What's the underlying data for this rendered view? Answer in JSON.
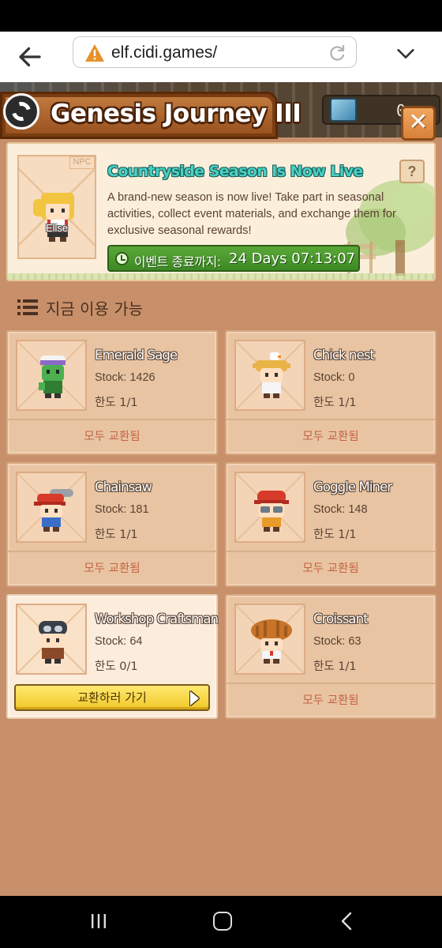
{
  "browser": {
    "url": "elf.cidi.games/"
  },
  "header": {
    "title": "Genesis Journey III",
    "currency_amount": "0",
    "close_label": "✕"
  },
  "event": {
    "npc_tag": "NPC",
    "npc_name": "Elise",
    "title": "Countryside Season Is Now Live",
    "description": "A brand-new season is now live! Take part in seasonal activities, collect event materials, and exchange them for exclusive seasonal rewards!",
    "timer_label": "이벤트 종료까지:",
    "timer_value": "24 Days  07:13:07",
    "help_label": "?"
  },
  "section": {
    "title": "지금 이용 가능"
  },
  "items": [
    {
      "name": "Emerald Sage",
      "stock": "Stock: 1426",
      "limit": "한도 1/1",
      "status": "모두 교환됨"
    },
    {
      "name": "Chick nest",
      "stock": "Stock: 0",
      "limit": "한도 1/1",
      "status": "모두 교환됨"
    },
    {
      "name": "Chainsaw",
      "stock": "Stock: 181",
      "limit": "한도 1/1",
      "status": "모두 교환됨"
    },
    {
      "name": "Goggle Miner",
      "stock": "Stock: 148",
      "limit": "한도 1/1",
      "status": "모두 교환됨"
    },
    {
      "name": "Workshop Craftsman",
      "stock": "Stock: 64",
      "limit": "한도 0/1",
      "button": "교환하러 가기"
    },
    {
      "name": "Croissant",
      "stock": "Stock: 63",
      "limit": "한도 1/1",
      "status": "모두 교환됨"
    }
  ],
  "colors": {
    "background": "#c8906a",
    "card": "#e8c4a2",
    "card_active": "#fcecdc",
    "accent_teal": "#48d0c4",
    "timer_green": "#3d8a24",
    "status_red": "#c46444",
    "button_yellow": "#f0c828"
  }
}
